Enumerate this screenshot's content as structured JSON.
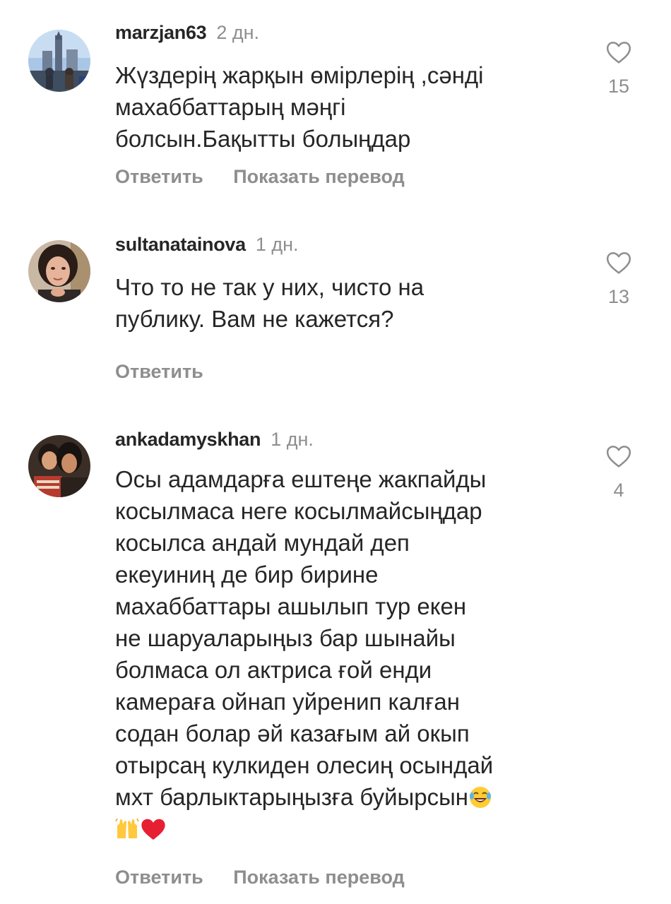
{
  "comments": [
    {
      "username": "marzjan63",
      "time": "2 дн.",
      "text": "Жүздерің жарқын өмірлерің ,сәнді\nмахаббаттарың мәңгі\nболсын.Бақытты болыңдар",
      "likes": "15",
      "reply_label": "Ответить",
      "translate_label": "Показать перевод",
      "avatar_icon": "avatar-photo-cityscape"
    },
    {
      "username": "sultanatainova",
      "time": "1 дн.",
      "text": "Что то не так у них, чисто на\nпублику. Вам не кажется?",
      "likes": "13",
      "reply_label": "Ответить",
      "avatar_icon": "avatar-photo-woman"
    },
    {
      "username": "ankadamyskhan",
      "time": "1 дн.",
      "text": "Осы адамдарға ештеңе жакпайды\nкосылмаса неге косылмайсыңдар\nкосылса андай мундай деп\nекеуиниң де бир бирине\nмахаббаттары ашылып тур екен\nне шаруаларыңыз бар шынайы\nболмаса ол актриса ғой енди\nкамераға ойнап уйренип калған\nсодан болар әй казағым ай окып\nотырсаң кулкиден олесиң осындай\nмхт барлыктарыңызға буйырсын",
      "likes": "4",
      "reply_label": "Ответить",
      "translate_label": "Показать перевод",
      "avatar_icon": "avatar-photo-two-people",
      "emojis": [
        "laughing-tears-emoji",
        "raised-hands-emoji",
        "red-heart-emoji"
      ]
    }
  ],
  "colors": {
    "text": "#262626",
    "muted": "#8e8e8e",
    "background": "#ffffff"
  }
}
